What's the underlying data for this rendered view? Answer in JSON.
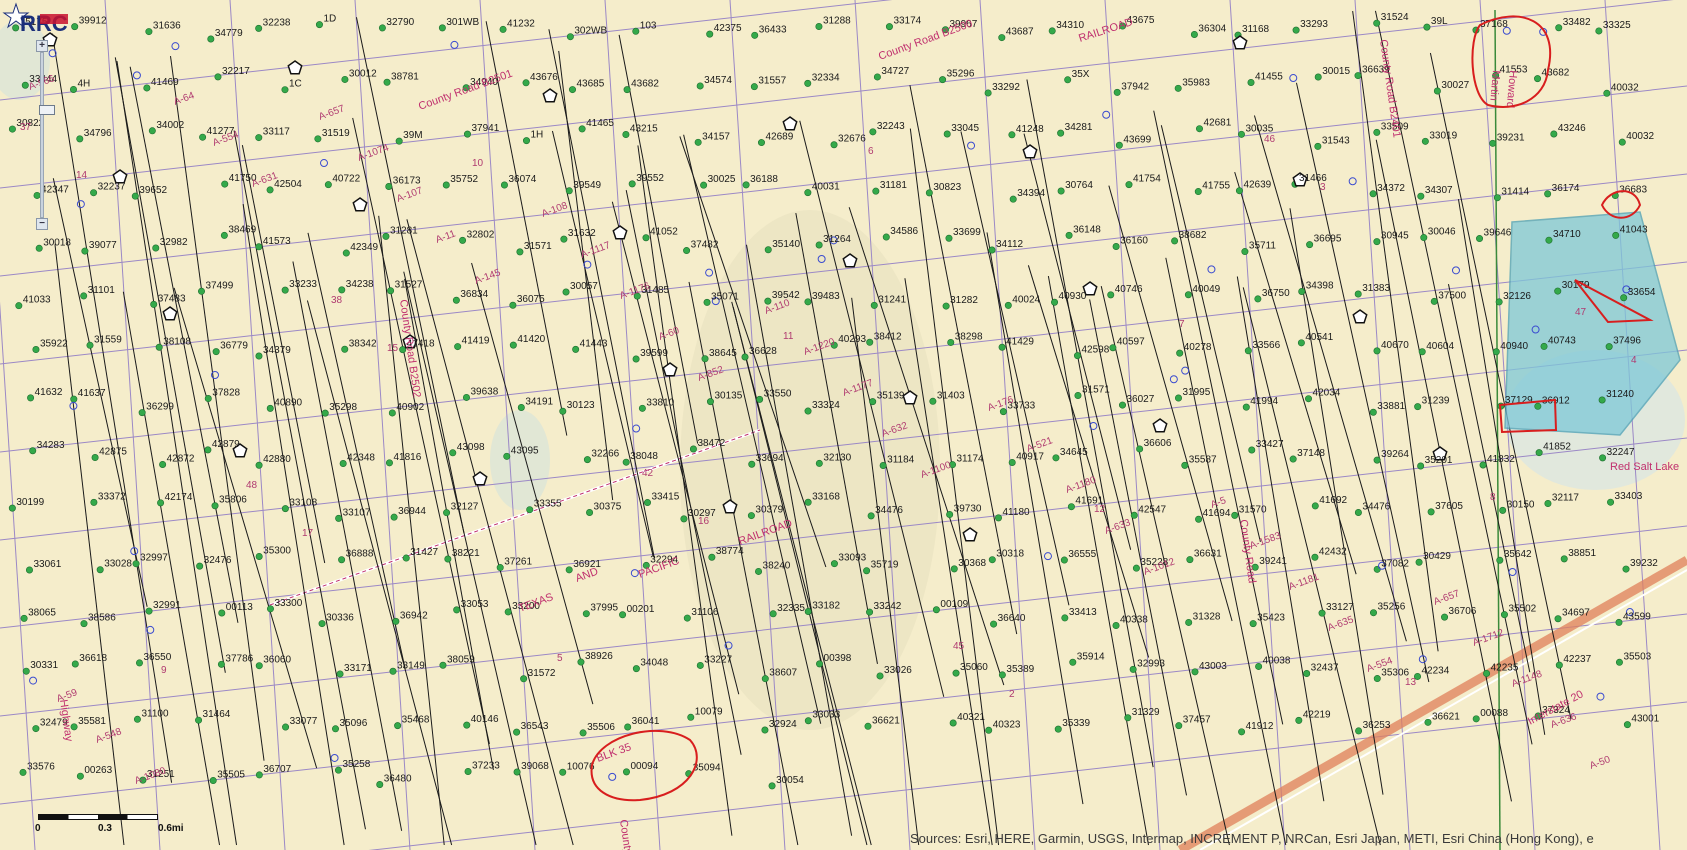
{
  "map": {
    "colors": {
      "background": "#f5edcb",
      "road_label": "#c0306e",
      "well": "#34a94a",
      "trajectory": "#1a1a1a",
      "highlight_fill": "#7ec8d8",
      "annotation": "#d81e1e",
      "railroad": "#c0306e",
      "interstate": "#e0805a"
    },
    "road_labels": [
      "County Road B2501",
      "County Road B2500",
      "County Road B2401",
      "County Road B2502",
      "RAILROAD",
      "RAILROAD",
      "TEXAS",
      "AND",
      "PACIFIC",
      "County Road",
      "County Road",
      "Highway",
      "Interstate 20",
      "Howard",
      "Martin",
      "Red Salt Lake",
      "BLK 35"
    ],
    "abstract_labels": [
      "A-566",
      "A-631",
      "A-145",
      "A-852",
      "A-1100",
      "A-1012",
      "A-554",
      "A-50",
      "A-554",
      "A-11",
      "A-60",
      "A-632",
      "A-633",
      "A-635",
      "A-636",
      "A-64",
      "A-107",
      "A-1176",
      "A-1177",
      "A-1180",
      "A-1181",
      "A-1148",
      "A-1080",
      "A-1074",
      "A-1117",
      "A-1220",
      "A-521",
      "A-1583",
      "A-1712",
      "A-548",
      "A-657",
      "A-108",
      "A-110",
      "A-176",
      "A-5",
      "A-657",
      "A-59"
    ],
    "section_numbers": [
      "37",
      "38",
      "42",
      "45",
      "46",
      "47",
      "48",
      "5",
      "6",
      "7",
      "8",
      "9",
      "10",
      "11",
      "12",
      "13",
      "14",
      "15",
      "16",
      "2",
      "3",
      "4",
      "17"
    ],
    "well_labels": [
      "35175",
      "39912",
      "31636",
      "34779",
      "32238",
      "1D",
      "32790",
      "301WB",
      "41232",
      "302WB",
      "103",
      "42375",
      "36433",
      "31288",
      "33174",
      "39967",
      "43687",
      "34310",
      "43675",
      "36304",
      "31168",
      "33293",
      "31524",
      "39L",
      "37168",
      "33482",
      "33325",
      "33444",
      "4H",
      "41469",
      "32217",
      "1C",
      "30012",
      "38781",
      "34940",
      "43676",
      "43685",
      "43682",
      "34574",
      "31557",
      "32334",
      "34727",
      "35296",
      "33292",
      "35X",
      "37942",
      "35983",
      "41455",
      "30015",
      "36639",
      "30027",
      "41553",
      "43682",
      "40032",
      "30822",
      "34796",
      "34002",
      "41277",
      "33117",
      "31519",
      "39M",
      "37941",
      "1H",
      "41465",
      "43215",
      "34157",
      "42689",
      "32676",
      "32243",
      "33045",
      "41248",
      "34281",
      "43699",
      "42681",
      "30035",
      "31543",
      "33509",
      "33019",
      "39231",
      "43246",
      "40032",
      "42347",
      "32237",
      "39652",
      "41750",
      "42504",
      "40722",
      "36173",
      "35752",
      "36074",
      "39549",
      "39552",
      "30025",
      "36188",
      "40031",
      "31181",
      "30823",
      "34394",
      "30764",
      "41754",
      "41755",
      "42639",
      "31466",
      "34372",
      "34307",
      "31414",
      "36174",
      "36683",
      "30018",
      "39077",
      "32982",
      "38469",
      "41573",
      "42349",
      "31281",
      "32802",
      "31571",
      "31632",
      "41052",
      "37482",
      "35140",
      "31264",
      "34586",
      "33699",
      "34112",
      "36148",
      "36160",
      "38682",
      "35711",
      "36695",
      "30945",
      "30046",
      "39646",
      "34710",
      "41043",
      "41033",
      "31101",
      "37483",
      "37499",
      "33233",
      "34238",
      "31527",
      "36834",
      "36075",
      "30057",
      "31485",
      "35071",
      "39542",
      "39483",
      "31241",
      "31282",
      "40024",
      "40930",
      "40746",
      "40049",
      "36750",
      "34398",
      "31383",
      "37500",
      "32126",
      "30179",
      "33654",
      "35922",
      "31559",
      "38108",
      "36779",
      "34379",
      "38342",
      "41418",
      "41419",
      "41420",
      "41443",
      "39599",
      "38645",
      "36628",
      "40293",
      "38412",
      "38298",
      "41429",
      "42598",
      "40597",
      "40278",
      "33566",
      "40541",
      "40670",
      "40604",
      "40940",
      "40743",
      "37496",
      "41632",
      "41637",
      "36299",
      "37828",
      "40890",
      "35298",
      "40902",
      "39638",
      "34191",
      "30123",
      "33810",
      "30135",
      "33550",
      "33324",
      "35139",
      "31403",
      "33733",
      "31571",
      "36027",
      "31995",
      "41994",
      "42034",
      "33881",
      "31239",
      "37129",
      "36912",
      "31240",
      "34283",
      "42875",
      "42872",
      "42879",
      "42880",
      "42348",
      "41816",
      "43098",
      "43095",
      "32266",
      "38048",
      "38472",
      "33694",
      "32130",
      "31184",
      "31174",
      "40917",
      "34645",
      "36606",
      "35587",
      "33427",
      "37148",
      "39264",
      "35201",
      "41832",
      "41852",
      "32247",
      "30199",
      "33372",
      "42174",
      "35806",
      "33108",
      "33107",
      "36944",
      "32127",
      "33355",
      "30375",
      "33415",
      "30297",
      "30379",
      "33168",
      "34476",
      "39730",
      "41180",
      "41691",
      "42547",
      "41694",
      "31570",
      "41692",
      "34476",
      "37605",
      "30150",
      "32117",
      "33403",
      "33061",
      "33028",
      "32997",
      "32476",
      "35300",
      "36888",
      "31427",
      "38221",
      "37261",
      "36921",
      "32294",
      "38774",
      "38240",
      "33093",
      "35719",
      "30368",
      "30318",
      "36555",
      "35228",
      "36631",
      "39241",
      "42432",
      "37082",
      "30429",
      "35642",
      "38851",
      "39232",
      "38065",
      "38586",
      "32991",
      "00113",
      "33300",
      "30336",
      "36942",
      "33053",
      "33200",
      "37995",
      "00201",
      "31106",
      "32335",
      "33182",
      "33242",
      "00109",
      "36640",
      "33413",
      "40338",
      "31328",
      "35423",
      "33127",
      "35256",
      "36706",
      "35502",
      "34697",
      "43599",
      "30331",
      "36618",
      "36550",
      "37786",
      "36060",
      "33171",
      "33149",
      "38059",
      "31572",
      "38926",
      "34048",
      "33227",
      "38607",
      "00398",
      "33026",
      "35060",
      "35389",
      "35914",
      "32993",
      "43003",
      "40038",
      "32437",
      "35306",
      "42234",
      "42235",
      "42237",
      "35503",
      "32479",
      "35581",
      "31100",
      "31464",
      "33077",
      "35096",
      "35468",
      "40146",
      "36543",
      "35506",
      "36041",
      "10079",
      "32924",
      "33033",
      "36621",
      "40321",
      "40323",
      "35339",
      "31329",
      "37457",
      "41912",
      "42219",
      "36253",
      "36621",
      "00088",
      "37324",
      "43001",
      "33576",
      "00263",
      "31251",
      "35505",
      "36707",
      "35258",
      "36480",
      "37233",
      "39068",
      "10076",
      "00094",
      "35094",
      "30054"
    ],
    "attribution": "Sources: Esri, HERE, Garmin, USGS, Intermap, INCREMENT P, NRCan, Esri Japan, METI, Esri China (Hong Kong), e",
    "scalebar": {
      "labels": [
        "0",
        "0.3",
        "0.6mi"
      ]
    },
    "zoom": {
      "in_label": "+",
      "out_label": "−"
    },
    "logo_text": "RRC"
  }
}
